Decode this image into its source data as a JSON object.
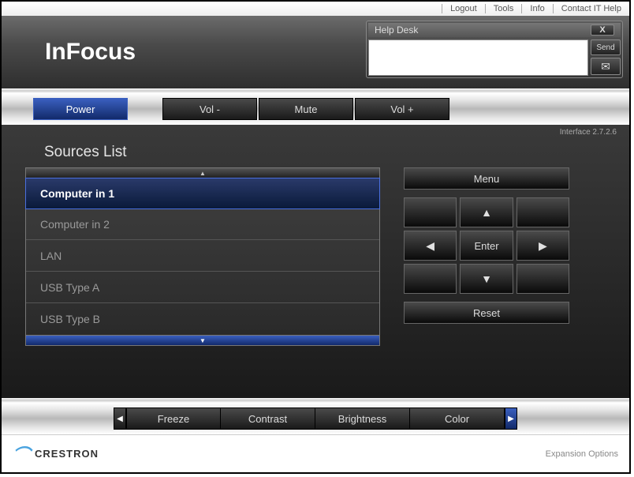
{
  "topmenu": {
    "logout": "Logout",
    "tools": "Tools",
    "info": "Info",
    "contact": "Contact IT Help"
  },
  "logo": "InFocus",
  "helpdesk": {
    "title": "Help Desk",
    "close": "X",
    "send": "Send",
    "message": ""
  },
  "bar1": {
    "power": "Power",
    "voldown": "Vol -",
    "mute": "Mute",
    "volup": "Vol +"
  },
  "interface_version": "Interface 2.7.2.6",
  "sources_title": "Sources List",
  "sources": {
    "items": [
      {
        "label": "Computer in 1"
      },
      {
        "label": "Computer in 2"
      },
      {
        "label": "LAN"
      },
      {
        "label": "USB Type A"
      },
      {
        "label": "USB Type B"
      }
    ]
  },
  "nav": {
    "menu": "Menu",
    "enter": "Enter",
    "reset": "Reset"
  },
  "bar2": {
    "freeze": "Freeze",
    "contrast": "Contrast",
    "brightness": "Brightness",
    "color": "Color"
  },
  "footer": {
    "brand": "CRESTRON",
    "expansion": "Expansion Options"
  }
}
